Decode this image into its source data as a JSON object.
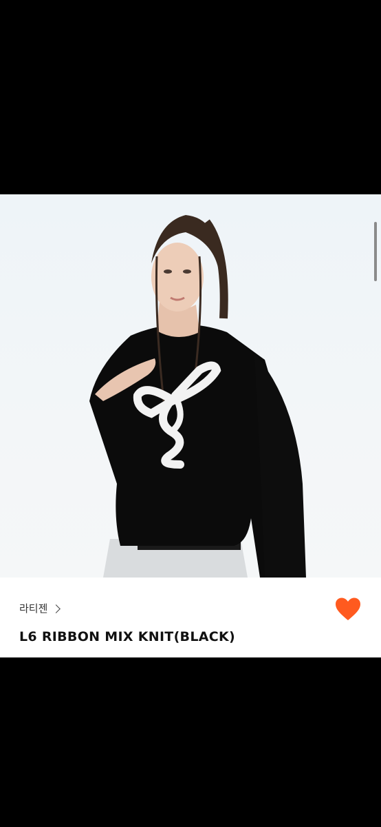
{
  "product": {
    "brand_label": "라티젠",
    "title": "L6 RIBBON MIX KNIT(BLACK)",
    "favorited": true
  },
  "colors": {
    "heart": "#ff5a1f",
    "background": "#000000",
    "panel": "#ffffff"
  },
  "icons": {
    "brand_chevron": "chevron-right-icon",
    "favorite": "heart-icon"
  }
}
